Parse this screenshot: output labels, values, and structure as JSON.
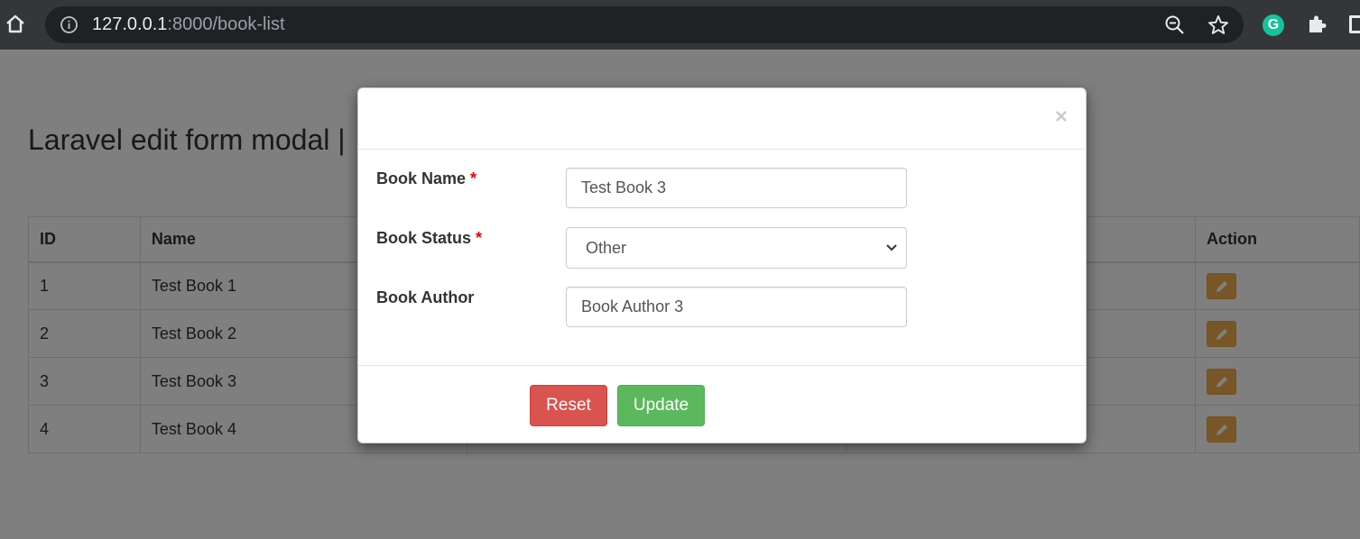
{
  "browser": {
    "url_host": "127.0.0.1",
    "url_path": ":8000/book-list",
    "grammarly_letter": "G"
  },
  "page": {
    "title": "Laravel edit form modal | "
  },
  "table": {
    "headers": [
      "ID",
      "Name",
      "",
      "",
      "Action"
    ],
    "rows": [
      {
        "id": "1",
        "name": "Test Book 1"
      },
      {
        "id": "2",
        "name": "Test Book 2"
      },
      {
        "id": "3",
        "name": "Test Book 3"
      },
      {
        "id": "4",
        "name": "Test Book 4"
      }
    ],
    "edit_button_color": "#f0ad4e"
  },
  "modal": {
    "close_symbol": "×",
    "fields": {
      "book_name": {
        "label": "Book Name",
        "required_mark": "*",
        "value": "Test Book 3"
      },
      "book_status": {
        "label": "Book Status",
        "required_mark": "*",
        "selected": "Other"
      },
      "book_author": {
        "label": "Book Author",
        "value": "Book Author 3"
      }
    },
    "buttons": {
      "reset": "Reset",
      "update": "Update"
    },
    "colors": {
      "reset": "#d9534f",
      "update": "#5cb85c",
      "required": "#ee0000"
    }
  }
}
